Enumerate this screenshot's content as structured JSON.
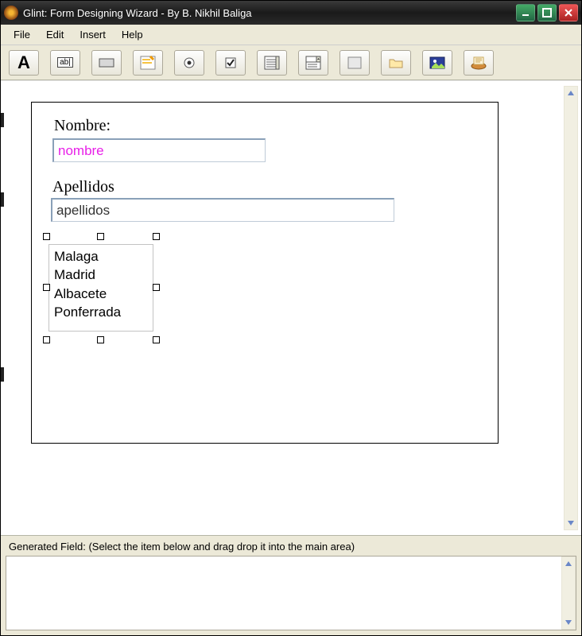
{
  "window": {
    "title": "Glint: Form Designing Wizard - By B. Nikhil Baliga"
  },
  "menu": {
    "items": [
      "File",
      "Edit",
      "Insert",
      "Help"
    ]
  },
  "toolbar": {
    "buttons": [
      "label-tool",
      "textbox-tool",
      "button-tool",
      "textarea-tool",
      "radio-tool",
      "checkbox-tool",
      "list-tool",
      "combo-tool",
      "panel-tool",
      "folder-tool",
      "image-tool",
      "scanner-tool"
    ]
  },
  "form": {
    "label1": "Nombre:",
    "input1": "nombre",
    "label2": "Apellidos",
    "input2": "apellidos",
    "listbox": [
      "Malaga",
      "Madrid",
      "Albacete",
      "Ponferrada"
    ]
  },
  "bottom": {
    "label": "Generated Field:  (Select the item below and drag drop it into the main area)"
  }
}
